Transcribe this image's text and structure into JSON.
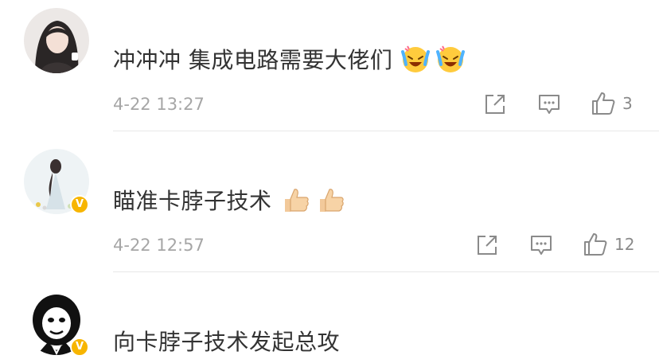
{
  "comments": [
    {
      "text": "冲冲冲 集成电路需要大佬们",
      "emojis": [
        "laugh-cry-emoji",
        "laugh-cry-emoji"
      ],
      "time": "4-22 13:27",
      "likes": "3",
      "verified": false
    },
    {
      "text": "瞄准卡脖子技术",
      "emojis": [
        "thumbs-up-emoji",
        "thumbs-up-emoji"
      ],
      "time": "4-22 12:57",
      "likes": "12",
      "verified": true
    },
    {
      "text": "向卡脖子技术发起总攻",
      "emojis": [],
      "verified": true
    }
  ],
  "colors": {
    "meta": "#a6a6a6",
    "icon": "#8a8a8a",
    "verified": "#f7b500",
    "divider": "#e8e8e8"
  },
  "icons": {
    "share": "share-icon",
    "comment": "comment-icon",
    "like": "like-icon"
  }
}
